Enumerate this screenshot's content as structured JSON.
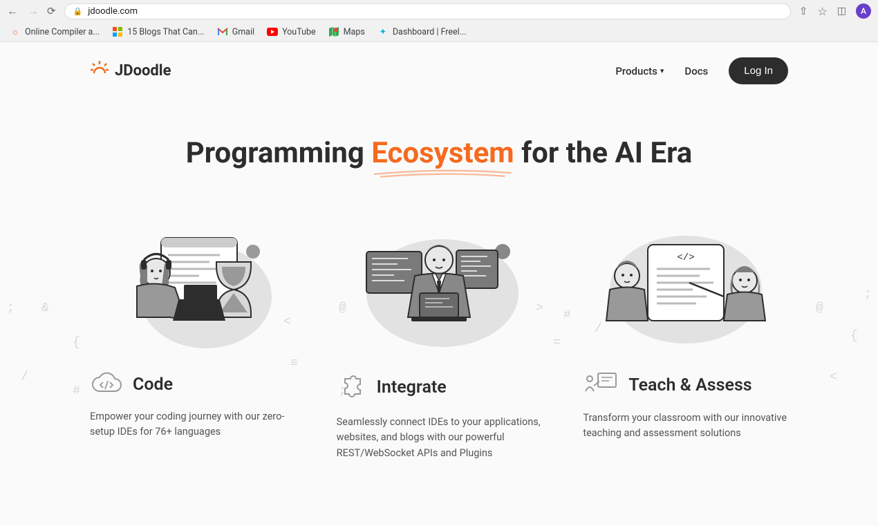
{
  "browser": {
    "url": "jdoodle.com",
    "avatar_initial": "A",
    "bookmarks": [
      {
        "label": "Online Compiler a...",
        "icon": "jdoodle"
      },
      {
        "label": "15 Blogs That Can...",
        "icon": "ms"
      },
      {
        "label": "Gmail",
        "icon": "gmail"
      },
      {
        "label": "YouTube",
        "icon": "yt"
      },
      {
        "label": "Maps",
        "icon": "maps"
      },
      {
        "label": "Dashboard | Freel...",
        "icon": "freel"
      }
    ]
  },
  "nav": {
    "brand": "JDoodle",
    "products": "Products",
    "docs": "Docs",
    "login": "Log In"
  },
  "hero": {
    "pre": "Programming ",
    "highlight": "Ecosystem",
    "post": " for the AI Era"
  },
  "features": [
    {
      "title": "Code",
      "desc": "Empower your coding journey with our zero-setup IDEs for 76+ languages"
    },
    {
      "title": "Integrate",
      "desc": "Seamlessly connect IDEs to your applications, websites, and blogs with our powerful REST/WebSocket APIs and Plugins"
    },
    {
      "title": "Teach & Assess",
      "desc": "Transform your classroom with our innovative teaching and assessment solutions"
    }
  ]
}
